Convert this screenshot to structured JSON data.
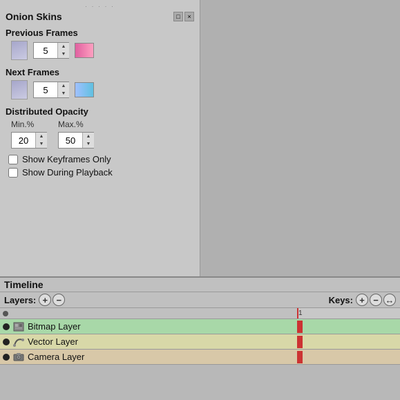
{
  "onion_skins": {
    "title": "Onion Skins",
    "drag_handle": "· · · · ·",
    "previous_frames": {
      "label": "Previous Frames",
      "count": "5",
      "color_label": "prev-color"
    },
    "next_frames": {
      "label": "Next Frames",
      "count": "5",
      "color_label": "next-color"
    },
    "distributed_opacity": {
      "label": "Distributed Opacity",
      "min_label": "Min.%",
      "max_label": "Max.%",
      "min_value": "20",
      "max_value": "50"
    },
    "show_keyframes_only": {
      "label": "Show Keyframes Only",
      "checked": false
    },
    "show_during_playback": {
      "label": "Show During Playback",
      "checked": false
    }
  },
  "timeline": {
    "title": "Timeline",
    "layers_label": "Layers:",
    "keys_label": "Keys:",
    "add_layer": "+",
    "remove_layer": "−",
    "add_key": "+",
    "remove_key": "−",
    "move_key": "↔",
    "layers": [
      {
        "name": "",
        "type": "empty",
        "row_class": "layer-row-0"
      },
      {
        "name": "Bitmap Layer",
        "type": "bitmap",
        "row_class": "layer-row-1"
      },
      {
        "name": "Vector Layer",
        "type": "vector",
        "row_class": "layer-row-2"
      },
      {
        "name": "Camera Layer",
        "type": "camera",
        "row_class": "layer-row-3"
      }
    ]
  },
  "icons": {
    "film_frame": "🎞",
    "bitmap": "🖼",
    "vector": "✏",
    "camera": "📷",
    "minimize": "□",
    "close": "×"
  }
}
